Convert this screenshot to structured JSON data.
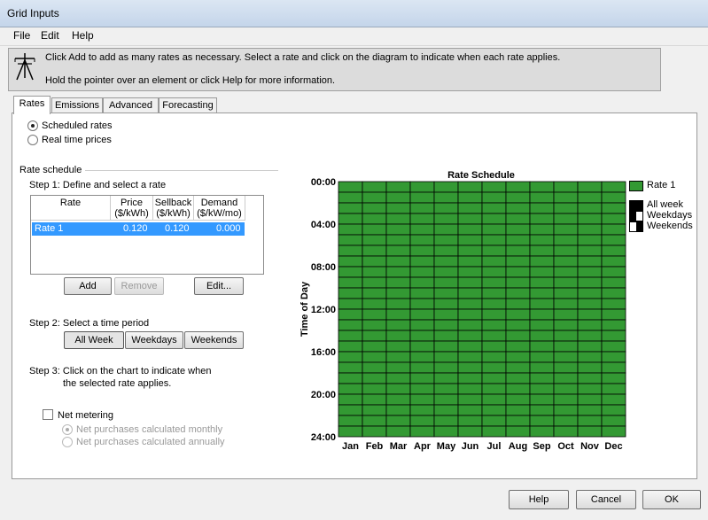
{
  "window": {
    "title": "Grid Inputs"
  },
  "menu": [
    "File",
    "Edit",
    "Help"
  ],
  "info": {
    "line1": "Click Add to add as many rates as necessary.  Select a rate and click on the diagram to indicate when each rate applies.",
    "line2": "Hold the pointer over an element or click Help for more information.",
    "icon": "power-tower-icon"
  },
  "tabs": [
    "Rates",
    "Emissions",
    "Advanced",
    "Forecasting"
  ],
  "active_tab": "Rates",
  "pricing": {
    "option1": "Scheduled rates",
    "option2": "Real time prices",
    "selected": "Scheduled rates"
  },
  "schedule": {
    "header": "Rate schedule",
    "step1": "Step 1:  Define and select a rate",
    "columns": [
      {
        "l1": "Rate",
        "l2": ""
      },
      {
        "l1": "Price",
        "l2": "($/kWh)"
      },
      {
        "l1": "Sellback",
        "l2": "($/kWh)"
      },
      {
        "l1": "Demand",
        "l2": "($/kW/mo)"
      }
    ],
    "rows": [
      {
        "rate": "Rate 1",
        "price": "0.120",
        "sellback": "0.120",
        "demand": "0.000"
      }
    ],
    "buttons": {
      "add": "Add",
      "remove": "Remove",
      "edit": "Edit..."
    },
    "step2": "Step 2:  Select a time period",
    "periods": [
      "All Week",
      "Weekdays",
      "Weekends"
    ],
    "selected_period": "All Week",
    "step3_line1": "Step 3:  Click on the chart to indicate when",
    "step3_line2": "the selected rate applies."
  },
  "net_metering": {
    "label": "Net metering",
    "checked": false,
    "opt1": "Net purchases calculated monthly",
    "opt2": "Net purchases calculated annually"
  },
  "chart_data": {
    "type": "heatmap",
    "title": "Rate Schedule",
    "ylabel": "Time of Day",
    "xlabel": "",
    "x": [
      "Jan",
      "Feb",
      "Mar",
      "Apr",
      "May",
      "Jun",
      "Jul",
      "Aug",
      "Sep",
      "Oct",
      "Nov",
      "Dec"
    ],
    "y_ticks": [
      "00:00",
      "04:00",
      "08:00",
      "12:00",
      "16:00",
      "20:00",
      "24:00"
    ],
    "hours": 24,
    "cell_rate": "Rate 1",
    "color": "#339933",
    "legend": {
      "rate": "Rate 1",
      "all_week": "All week",
      "weekdays": "Weekdays",
      "weekends": "Weekends"
    }
  },
  "footer": {
    "help": "Help",
    "cancel": "Cancel",
    "ok": "OK"
  }
}
